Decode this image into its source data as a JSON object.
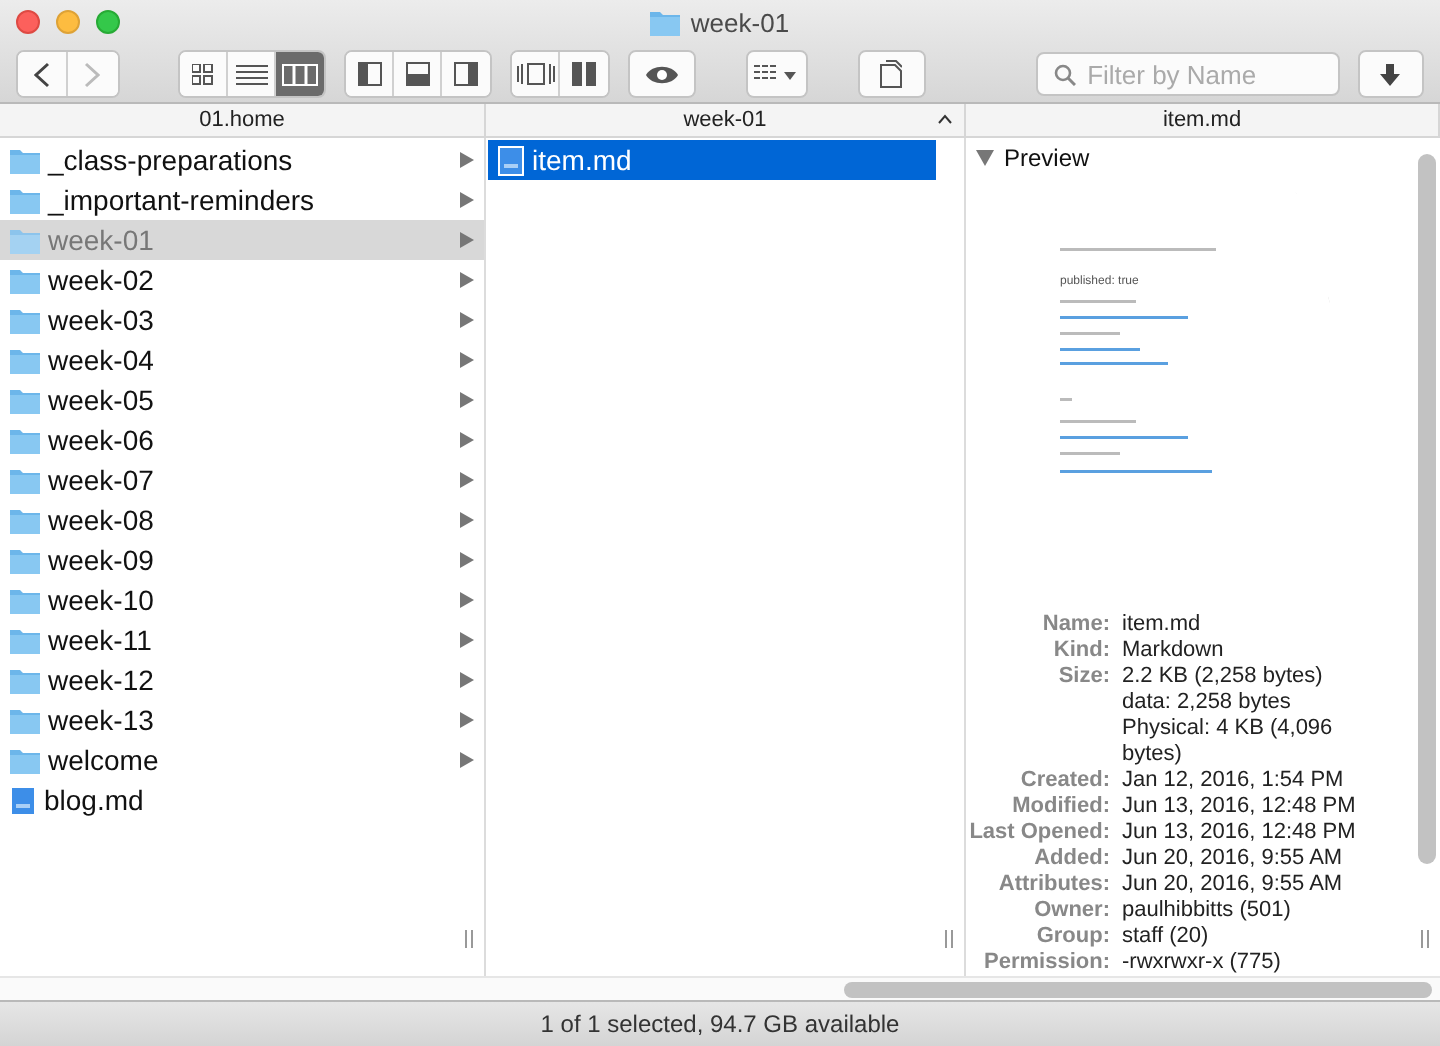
{
  "window": {
    "title": "week-01"
  },
  "toolbar": {
    "view_modes": [
      {
        "kind": "icons",
        "selected": false
      },
      {
        "kind": "list",
        "selected": false
      },
      {
        "kind": "columns",
        "selected": true
      }
    ],
    "search": {
      "placeholder": "Filter by Name"
    }
  },
  "columns": [
    {
      "header": "01.home",
      "sorted": false,
      "items": [
        {
          "name": "_class-preparations",
          "kind": "folder",
          "selected": false
        },
        {
          "name": "_important-reminders",
          "kind": "folder",
          "selected": false
        },
        {
          "name": "week-01",
          "kind": "folder",
          "selected": true
        },
        {
          "name": "week-02",
          "kind": "folder",
          "selected": false
        },
        {
          "name": "week-03",
          "kind": "folder",
          "selected": false
        },
        {
          "name": "week-04",
          "kind": "folder",
          "selected": false
        },
        {
          "name": "week-05",
          "kind": "folder",
          "selected": false
        },
        {
          "name": "week-06",
          "kind": "folder",
          "selected": false
        },
        {
          "name": "week-07",
          "kind": "folder",
          "selected": false
        },
        {
          "name": "week-08",
          "kind": "folder",
          "selected": false
        },
        {
          "name": "week-09",
          "kind": "folder",
          "selected": false
        },
        {
          "name": "week-10",
          "kind": "folder",
          "selected": false
        },
        {
          "name": "week-11",
          "kind": "folder",
          "selected": false
        },
        {
          "name": "week-12",
          "kind": "folder",
          "selected": false
        },
        {
          "name": "week-13",
          "kind": "folder",
          "selected": false
        },
        {
          "name": "welcome",
          "kind": "folder",
          "selected": false
        },
        {
          "name": "blog.md",
          "kind": "file",
          "selected": false
        }
      ]
    },
    {
      "header": "week-01",
      "sorted": true,
      "items": [
        {
          "name": "item.md",
          "kind": "file",
          "selected": true
        }
      ]
    }
  ],
  "preview": {
    "header": "item.md",
    "heading": "Preview",
    "expanded": true,
    "document_heading": "published: true",
    "info": [
      {
        "label": "Name:",
        "value": "item.md"
      },
      {
        "label": "Kind:",
        "value": "Markdown"
      },
      {
        "label": "Size:",
        "value": "2.2 KB (2,258 bytes)"
      },
      {
        "value": "data: 2,258 bytes"
      },
      {
        "value": "Physical: 4 KB (4,096 bytes)"
      },
      {
        "label": "Created:",
        "value": "Jan 12, 2016, 1:54 PM"
      },
      {
        "label": "Modified:",
        "value": "Jun 13, 2016, 12:48 PM"
      },
      {
        "label": "Last Opened:",
        "value": "Jun 13, 2016, 12:48 PM"
      },
      {
        "label": "Added:",
        "value": "Jun 20, 2016, 9:55 AM"
      },
      {
        "label": "Attributes:",
        "value": "Jun 20, 2016, 9:55 AM"
      },
      {
        "label": "Owner:",
        "value": "paulhibbitts (501)"
      },
      {
        "label": "Group:",
        "value": "staff (20)"
      },
      {
        "label": "Permission:",
        "value": "-rwxrwxr-x (775)"
      }
    ]
  },
  "status_bar": "1 of 1 selected, 94.7 GB available"
}
